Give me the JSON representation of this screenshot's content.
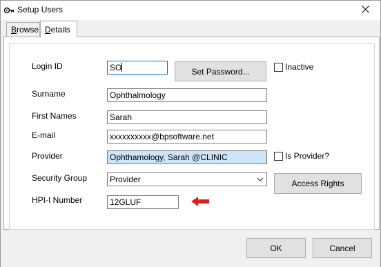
{
  "window": {
    "title": "Setup Users",
    "close_glyph": "✕"
  },
  "tabs": [
    {
      "label_prefix": "",
      "label_underlined": "B",
      "label_rest": "rowse"
    },
    {
      "label_prefix": "",
      "label_underlined": "D",
      "label_rest": "etails"
    }
  ],
  "form": {
    "login_id": {
      "label": "Login ID",
      "value": "SO"
    },
    "surname": {
      "label": "Surname",
      "value": "Ophthalmology"
    },
    "first_names": {
      "label": "First Names",
      "value": "Sarah"
    },
    "email": {
      "label": "E-mail",
      "value": "xxxxxxxxxx@bpsoftware.net"
    },
    "provider": {
      "label": "Provider",
      "value": "Ophthamology, Sarah @CLINIC"
    },
    "security_group": {
      "label": "Security Group",
      "value": "Provider"
    },
    "hpi_i_number": {
      "label": "HPI-I Number",
      "value": "12GLUF"
    }
  },
  "buttons": {
    "set_password": "Set Password...",
    "access_rights": "Access Rights",
    "ok": "OK",
    "cancel": "Cancel"
  },
  "checkboxes": {
    "inactive": {
      "label": "Inactive",
      "checked": false
    },
    "is_provider": {
      "label": "Is Provider?",
      "checked": false
    }
  },
  "colors": {
    "arrow": "#e02020",
    "selection": "#cce4f7",
    "focus_border": "#0078d7"
  },
  "icons": {
    "app": "key-icon",
    "close": "close-icon",
    "dropdown": "chevron-down-icon",
    "annotation": "red-arrow-icon"
  }
}
